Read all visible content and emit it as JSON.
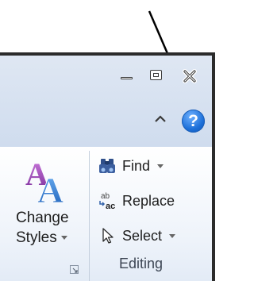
{
  "window": {
    "minimize_icon": "minimize-icon",
    "maximize_icon": "maximize-icon",
    "close_icon": "close-icon",
    "collapse_ribbon_icon": "chevron-up-icon",
    "help_label": "?"
  },
  "styles_group": {
    "change_styles_line1": "Change",
    "change_styles_line2": "Styles"
  },
  "editing_group": {
    "label": "Editing",
    "find_label": "Find",
    "replace_label": "Replace",
    "select_label": "Select"
  },
  "colors": {
    "help_blue": "#1c6fd8",
    "ribbon_bg": "#eef3fa",
    "title_bg": "#dfe7f3"
  }
}
